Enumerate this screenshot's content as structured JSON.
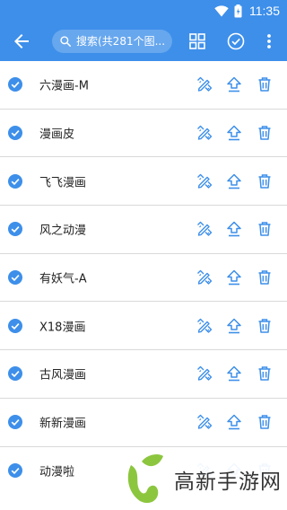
{
  "status_bar": {
    "time": "11:35",
    "icons": [
      "wifi-icon",
      "battery-icon"
    ]
  },
  "app_bar": {
    "back_icon": "arrow-left-icon",
    "search_placeholder": "搜索(共281个图...",
    "actions": [
      "grid-view-icon",
      "check-circle-icon",
      "more-vert-icon"
    ]
  },
  "colors": {
    "primary": "#3d8fea",
    "icon": "#3d8fea",
    "divider": "#d9d9d9",
    "text": "#222222"
  },
  "items": [
    {
      "name": "六漫画-M",
      "checked": true
    },
    {
      "name": "漫画皮",
      "checked": true
    },
    {
      "name": "飞飞漫画",
      "checked": true
    },
    {
      "name": "风之动漫",
      "checked": true
    },
    {
      "name": "有妖气-A",
      "checked": true
    },
    {
      "name": "X18漫画",
      "checked": true
    },
    {
      "name": "古风漫画",
      "checked": true
    },
    {
      "name": "新新漫画",
      "checked": true
    },
    {
      "name": "动漫啦",
      "checked": true
    }
  ],
  "row_actions": [
    "edit-icon",
    "upload-icon",
    "delete-icon"
  ],
  "watermark": {
    "text": "高新手游网"
  }
}
